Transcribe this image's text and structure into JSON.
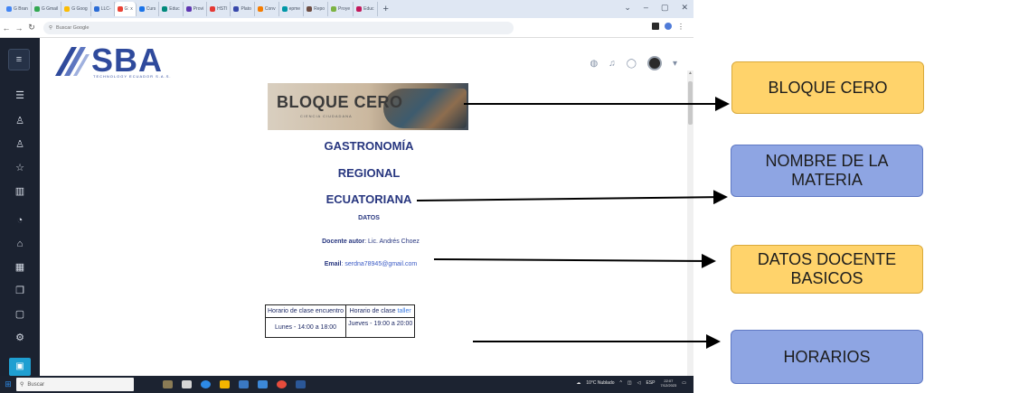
{
  "browser": {
    "tabs": [
      {
        "label": "G Bran",
        "color": "#4285f4"
      },
      {
        "label": "G Gmail",
        "color": "#34a853"
      },
      {
        "label": "G Goog",
        "color": "#fbbc05"
      },
      {
        "label": "LLC-",
        "color": "#2b6cd6"
      },
      {
        "label": "G: x",
        "color": "#ea4335",
        "active": true
      },
      {
        "label": "Curs",
        "color": "#1a73e8"
      },
      {
        "label": "Educ",
        "color": "#00897b"
      },
      {
        "label": "Provi",
        "color": "#5e35b1"
      },
      {
        "label": "HSTI",
        "color": "#e53935"
      },
      {
        "label": "Plato",
        "color": "#3949ab"
      },
      {
        "label": "Conv",
        "color": "#f57c00"
      },
      {
        "label": "epme",
        "color": "#0097a7"
      },
      {
        "label": "Repo",
        "color": "#6d4c41"
      },
      {
        "label": "Proye",
        "color": "#7cb342"
      },
      {
        "label": "Educ",
        "color": "#c2185b"
      }
    ],
    "new_tab": "+",
    "address_text": "Buscar Google",
    "window_controls": [
      "⌄",
      "–",
      "▢",
      "✕"
    ]
  },
  "logo": {
    "text": "SBA",
    "subtext": "TECHNOLOGY ECUADOR S.A.S."
  },
  "banner": {
    "title": "BLOQUE CERO",
    "subtitle": "CIENCIA CIUDADANA"
  },
  "materia": {
    "line1": "GASTRONOMÍA",
    "line2": "REGIONAL",
    "line3": "ECUATORIANA"
  },
  "datos": {
    "heading": "DATOS",
    "docente_label": "Docente autor",
    "docente_value": ": Lic. Andrés Choez",
    "email_label": "Email",
    "email_value": ": serdna78945@gmail.com"
  },
  "horarios": {
    "header_1": "Horario de clase encuentro",
    "header_2a": "Horario de clase ",
    "header_2b": "taller",
    "row_1": "Lunes - 14:00 a 18:00",
    "row_2": "Jueves - 19:00 a 20:00"
  },
  "taskbar": {
    "search": "Buscar",
    "weather": "10°C Nublado",
    "lang": "ESP",
    "time": "22:07",
    "date": "7/12/2023"
  },
  "callouts": {
    "bloque": "BLOQUE CERO",
    "materia": "NOMBRE DE LA MATERIA",
    "datos": "DATOS DOCENTE BASICOS",
    "horarios": "HORARIOS"
  },
  "colors": {
    "yellow": "#ffd36b",
    "blue": "#8ea5e3",
    "sidebar": "#1b2230",
    "text_blue": "#27367f"
  }
}
